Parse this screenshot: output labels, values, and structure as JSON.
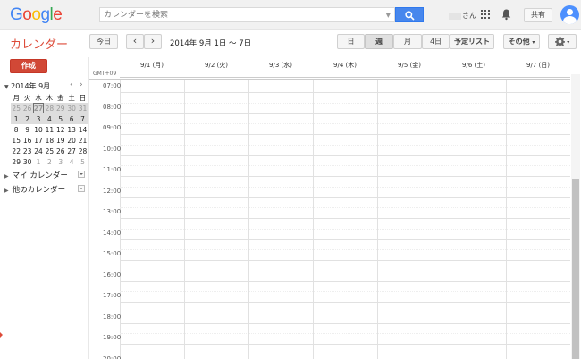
{
  "header": {
    "logo_letters": [
      "G",
      "o",
      "o",
      "g",
      "l",
      "e"
    ],
    "logo_colors": [
      "#4285f4",
      "#ea4335",
      "#fbbc05",
      "#4285f4",
      "#34a853",
      "#ea4335"
    ],
    "search_placeholder": "カレンダーを検索",
    "user_suffix": "さん",
    "share_label": "共有"
  },
  "toolbar": {
    "app_title": "カレンダー",
    "today_label": "今日",
    "prev_label": "‹",
    "next_label": "›",
    "date_range": "2014年 9月 1日 ～ 7日",
    "view_day": "日",
    "view_week": "週",
    "view_month": "月",
    "view_4days": "4日",
    "view_agenda": "予定リスト",
    "more_label": "その他",
    "settings_caret": "▾"
  },
  "sidebar": {
    "create_label": "作成",
    "mini_month": "2014年 9月",
    "weekdays": [
      "月",
      "火",
      "水",
      "木",
      "金",
      "土",
      "日"
    ],
    "weeks": [
      [
        "25",
        "26",
        "27",
        "28",
        "29",
        "30",
        "31"
      ],
      [
        "1",
        "2",
        "3",
        "4",
        "5",
        "6",
        "7"
      ],
      [
        "8",
        "9",
        "10",
        "11",
        "12",
        "13",
        "14"
      ],
      [
        "15",
        "16",
        "17",
        "18",
        "19",
        "20",
        "21"
      ],
      [
        "22",
        "23",
        "24",
        "25",
        "26",
        "27",
        "28"
      ],
      [
        "29",
        "30",
        "1",
        "2",
        "3",
        "4",
        "5"
      ]
    ],
    "my_calendars": "マイ カレンダー",
    "other_calendars": "他のカレンダー"
  },
  "grid": {
    "timezone": "GMT+09",
    "days": [
      "9/1 (月)",
      "9/2 (火)",
      "9/3 (水)",
      "9/4 (木)",
      "9/5 (金)",
      "9/6 (土)",
      "9/7 (日)"
    ],
    "hours": [
      "07:00",
      "08:00",
      "09:00",
      "10:00",
      "11:00",
      "12:00",
      "13:00",
      "14:00",
      "15:00",
      "16:00",
      "17:00",
      "18:00",
      "19:00",
      "20:00"
    ]
  },
  "colors": {
    "accent_red": "#dd4b39",
    "search_blue": "#4787ed"
  }
}
